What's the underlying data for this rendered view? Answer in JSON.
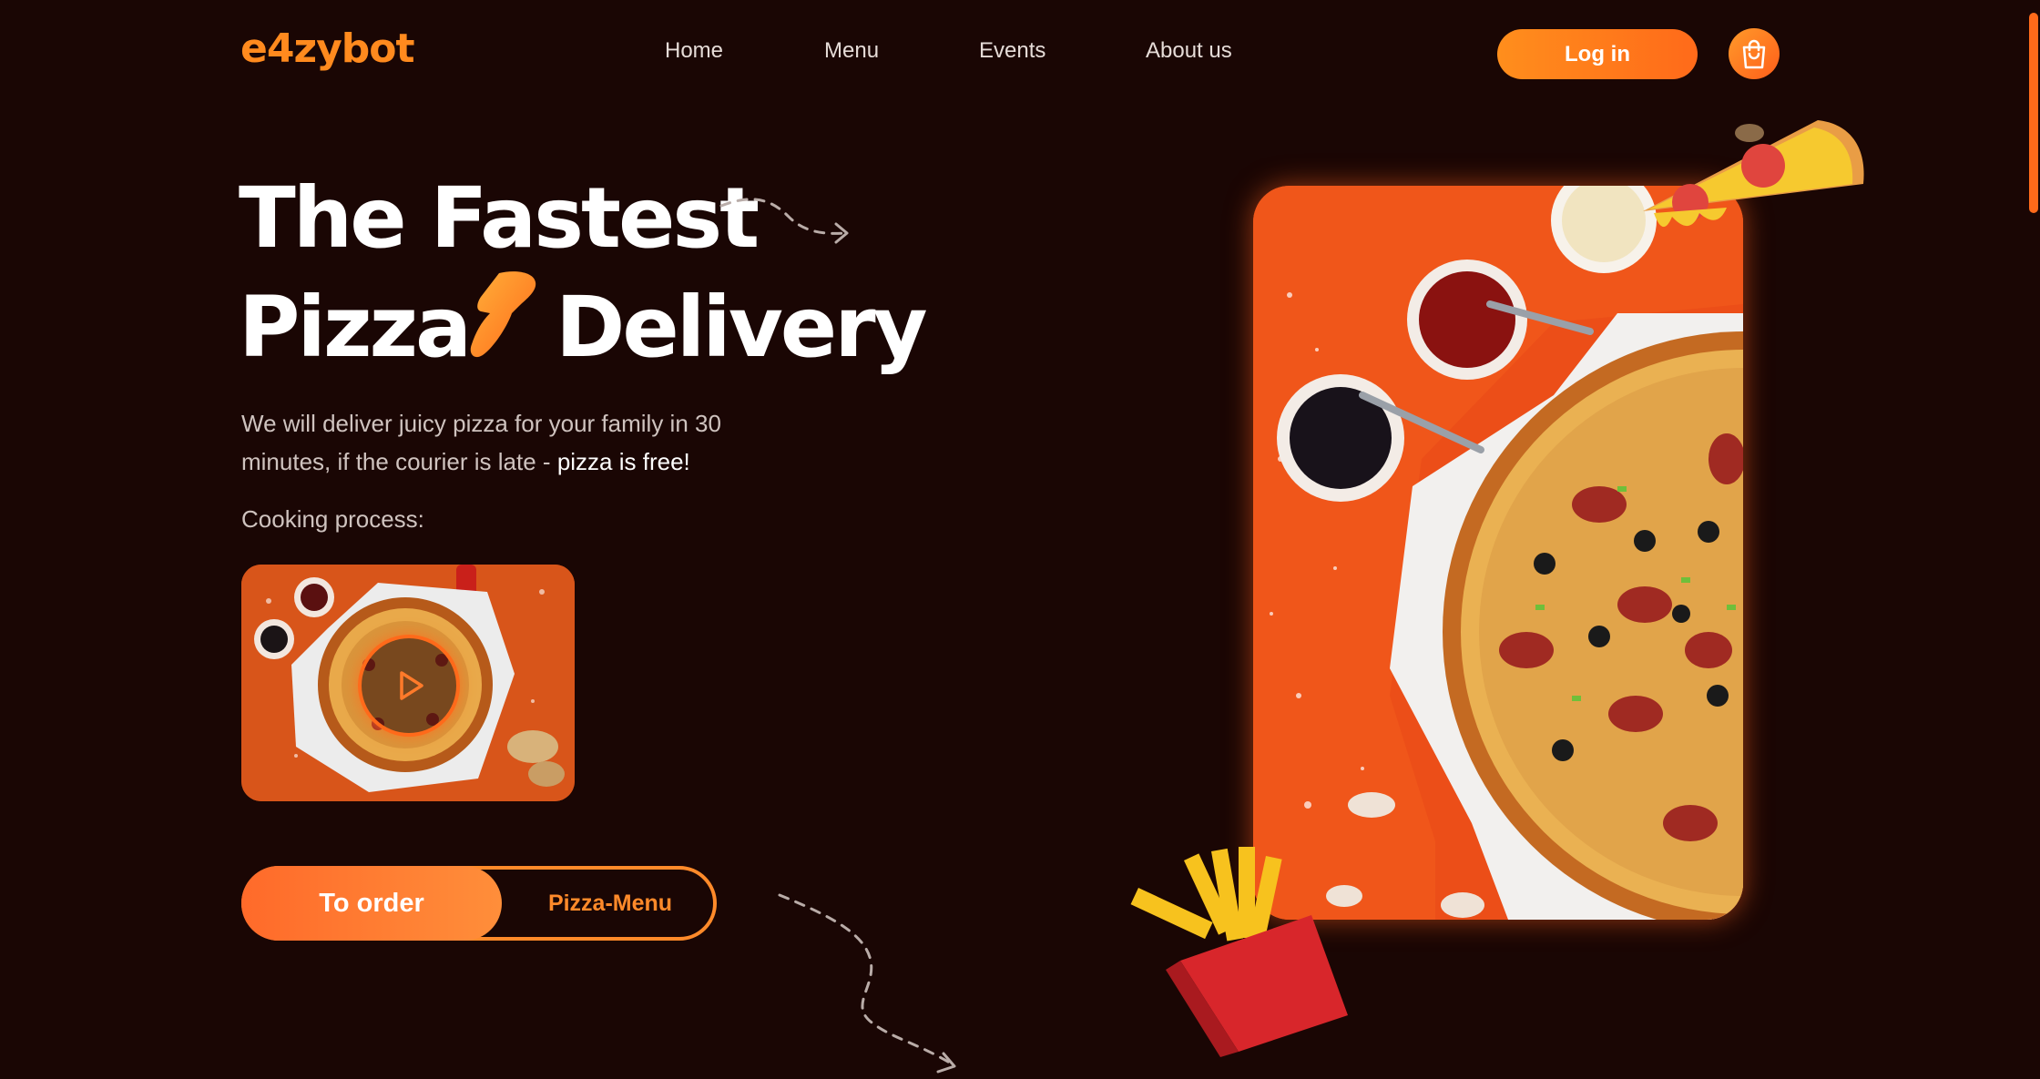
{
  "header": {
    "logo": "e4zybot",
    "nav": [
      "Home",
      "Menu",
      "Events",
      "About us"
    ],
    "login_label": "Log in",
    "cart_icon": "shopping-bag-icon"
  },
  "hero": {
    "title_line1": "The Fastest",
    "title_line2_a": "Pizza",
    "title_line2_b": "Delivery",
    "subtitle_text": "We will deliver juicy pizza for your family in 30 minutes, if the courier is late -",
    "subtitle_highlight": "pizza is free!",
    "cooking_label": "Cooking process:",
    "order_button": "To order",
    "menu_button": "Pizza-Menu"
  },
  "colors": {
    "background": "#1a0604",
    "accent": "#ff8a1e",
    "accent_red": "#ff5e1a"
  }
}
